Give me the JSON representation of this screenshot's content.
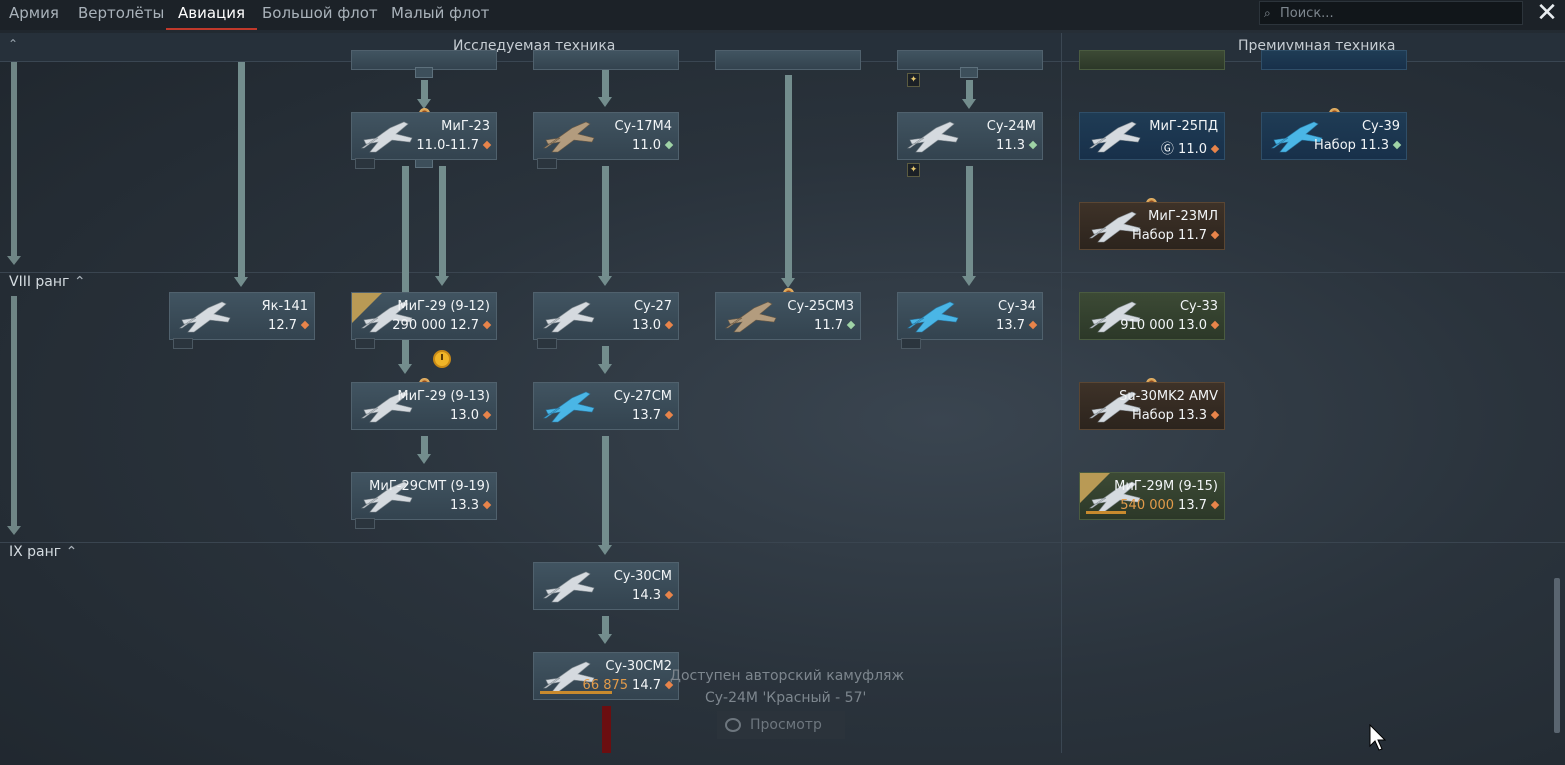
{
  "tabs": [
    "Армия",
    "Вертолёты",
    "Авиация",
    "Большой флот",
    "Малый флот"
  ],
  "active_tab": "Авиация",
  "search": {
    "placeholder": "Поиск..."
  },
  "sections": {
    "researchable": "Исследуемая техника",
    "premium": "Премиумная техника"
  },
  "ranks": {
    "viii": "VIII ранг",
    "ix": "IX ранг"
  },
  "vehicles": {
    "mig23": {
      "name": "МиГ-23",
      "br": "11.0-11.7"
    },
    "su17m4": {
      "name": "Су-17М4",
      "br": "11.0"
    },
    "su24m": {
      "name": "Су-24М",
      "br": "11.3"
    },
    "mig25pd": {
      "name": "МиГ-25ПД",
      "br": "11.0",
      "pack": "Ⓖ"
    },
    "su39": {
      "name": "Су-39",
      "prefix": "Набор",
      "br": "11.3"
    },
    "mig23ml": {
      "name": "МиГ-23МЛ",
      "prefix": "Набор",
      "br": "11.7"
    },
    "yak141": {
      "name": "Як-141",
      "br": "12.7"
    },
    "mig29_912": {
      "name": "МиГ-29 (9-12)",
      "cost": "290 000",
      "br": "12.7"
    },
    "su27": {
      "name": "Су-27",
      "br": "13.0"
    },
    "su25sm3": {
      "name": "Су-25СМ3",
      "br": "11.7"
    },
    "su34": {
      "name": "Су-34",
      "br": "13.7"
    },
    "su33": {
      "name": "Су-33",
      "cost": "910 000",
      "br": "13.0"
    },
    "mig29_913": {
      "name": "МиГ-29 (9-13)",
      "br": "13.0"
    },
    "su27sm": {
      "name": "Су-27СМ",
      "br": "13.7"
    },
    "su30mk2": {
      "name": "Su-30MK2 AMV",
      "prefix": "Набор",
      "br": "13.3"
    },
    "mig29smt": {
      "name": "МиГ-29СМТ (9-19)",
      "br": "13.3"
    },
    "mig29m": {
      "name": "МиГ-29М (9-15)",
      "cost": "540 000",
      "br": "13.7"
    },
    "su30sm": {
      "name": "Су-30СМ",
      "br": "14.3"
    },
    "su30sm2": {
      "name": "Су-30СМ2",
      "cost": "66 875",
      "br": "14.7"
    }
  },
  "notification": {
    "line1": "Доступен авторский камуфляж",
    "line2": "Су-24М 'Красный - 57'",
    "button": "Просмотр"
  },
  "colors": {
    "accent_tab": "#c0392b",
    "arrow": "#738d8d",
    "cost_orange": "#e29b4a"
  }
}
